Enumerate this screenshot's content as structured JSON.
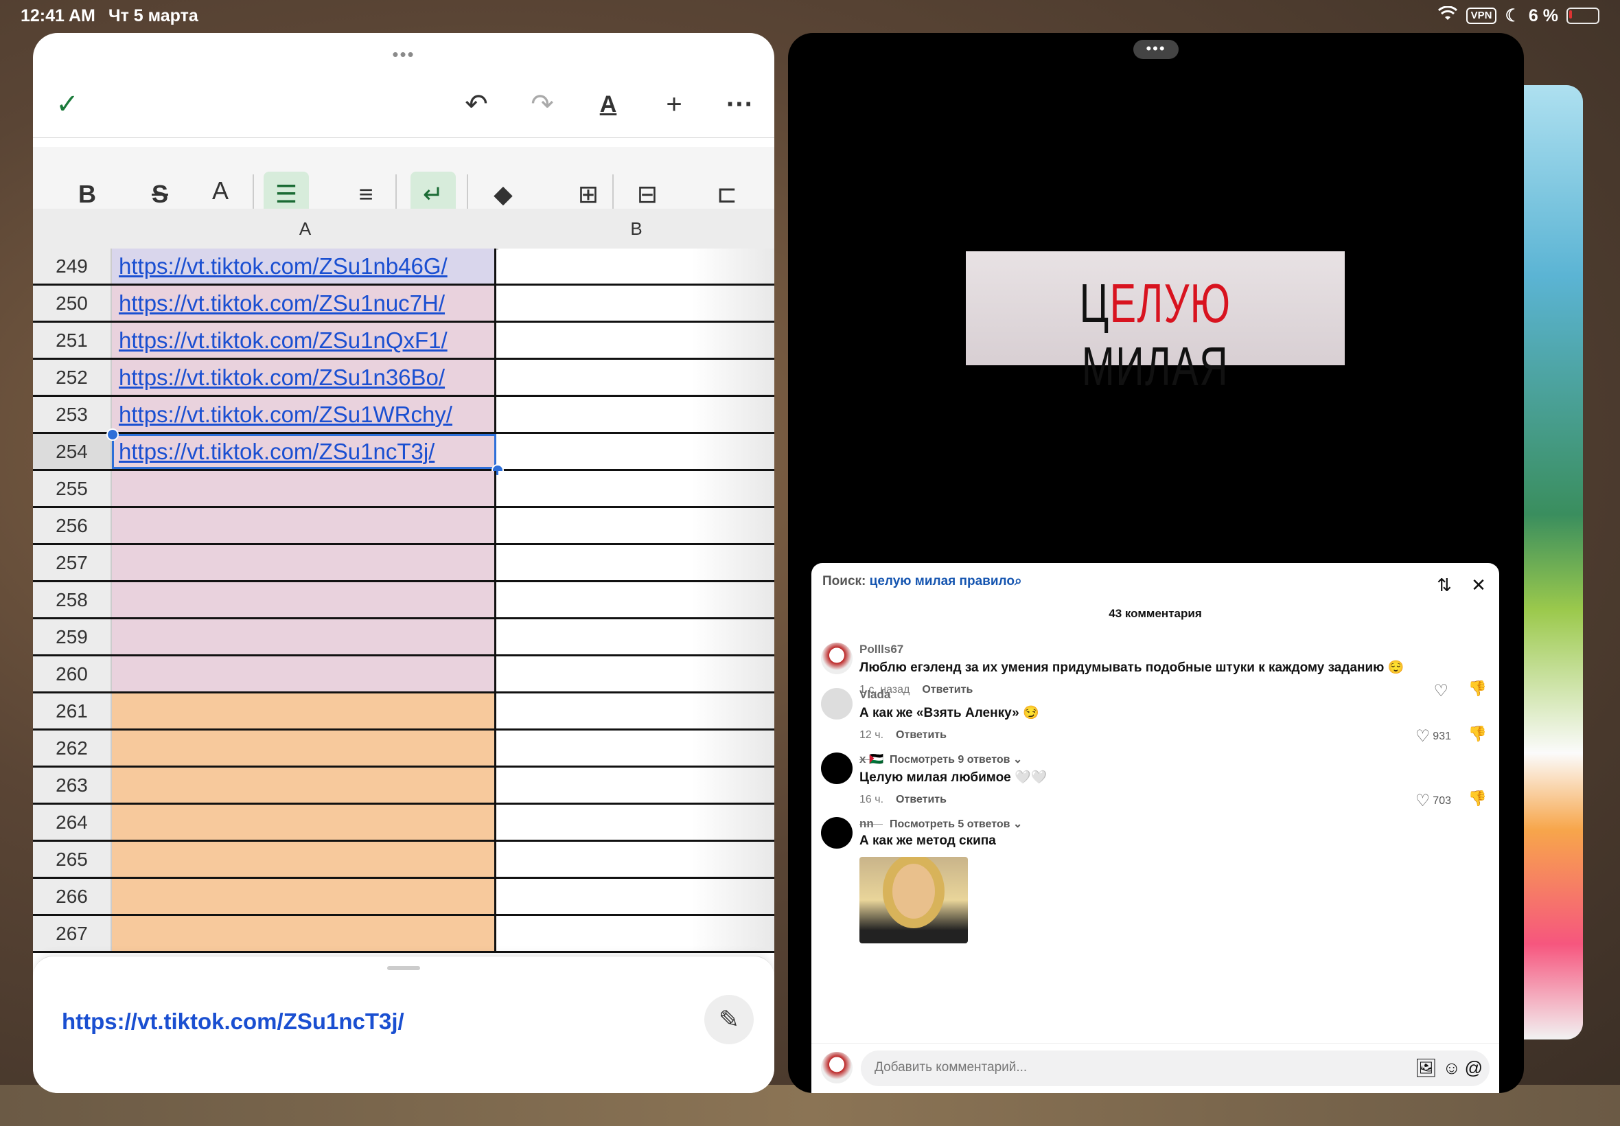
{
  "status": {
    "time": "12:41 AM",
    "date": "Чт 5 марта",
    "vpn": "VPN",
    "battery": "6 %"
  },
  "sheet": {
    "toolbar": {
      "confirm_icon": "check-icon",
      "undo_icon": "undo-icon",
      "redo_icon": "redo-icon",
      "text_format_icon": "text-format-icon",
      "add_icon": "plus-icon",
      "more_icon": "more-icon"
    },
    "format_bar": {
      "bold": "B",
      "strike": "S",
      "text_color": "A"
    },
    "columns": [
      "A",
      "B"
    ],
    "rows": [
      {
        "n": "249",
        "a": "https://vt.tiktok.com/ZSu1nb46G/",
        "fill": "lav"
      },
      {
        "n": "250",
        "a": "https://vt.tiktok.com/ZSu1nuc7H/",
        "fill": "pink"
      },
      {
        "n": "251",
        "a": "https://vt.tiktok.com/ZSu1nQxF1/",
        "fill": "pink"
      },
      {
        "n": "252",
        "a": "https://vt.tiktok.com/ZSu1n36Bo/",
        "fill": "pink"
      },
      {
        "n": "253",
        "a": "https://vt.tiktok.com/ZSu1WRchy/",
        "fill": "pink"
      },
      {
        "n": "254",
        "a": "https://vt.tiktok.com/ZSu1ncT3j/",
        "fill": "pink"
      },
      {
        "n": "255",
        "a": "",
        "fill": "pink"
      },
      {
        "n": "256",
        "a": "",
        "fill": "pink"
      },
      {
        "n": "257",
        "a": "",
        "fill": "pink"
      },
      {
        "n": "258",
        "a": "",
        "fill": "pink"
      },
      {
        "n": "259",
        "a": "",
        "fill": "pink"
      },
      {
        "n": "260",
        "a": "",
        "fill": "pink"
      },
      {
        "n": "261",
        "a": "",
        "fill": "orange"
      },
      {
        "n": "262",
        "a": "",
        "fill": "orange"
      },
      {
        "n": "263",
        "a": "",
        "fill": "orange"
      },
      {
        "n": "264",
        "a": "",
        "fill": "orange"
      },
      {
        "n": "265",
        "a": "",
        "fill": "orange"
      },
      {
        "n": "266",
        "a": "",
        "fill": "orange"
      },
      {
        "n": "267",
        "a": "",
        "fill": "orange"
      }
    ],
    "selected_row": "254",
    "cell_editor_value": "https://vt.tiktok.com/ZSu1ncT3j/",
    "colors": {
      "pink": "#e9d2dd",
      "lav": "#d9d6ec",
      "orange": "#f7c99c",
      "selection": "#2e6fd8",
      "link": "#1a4fd1"
    }
  },
  "tiktok": {
    "video_caption_black1": "Ц",
    "video_caption_red1": "ЕЛУЮ",
    "video_caption_black2": "МИЛАЯ",
    "search_label": "Поиск:",
    "search_query": "целую милая правило",
    "comment_count": "43 комментария",
    "comments": [
      {
        "user": "Pollls67",
        "text": "Люблю егэленд за их умения придумывать подобные штуки к каждому заданию 😌",
        "time": "1 с. назад",
        "reply": "Ответить",
        "likes": ""
      },
      {
        "user": "Vlada",
        "text": "А как же «Взять Аленку» 😏",
        "time": "12 ч.",
        "reply": "Ответить",
        "likes": "931",
        "replies": "Посмотреть 9 ответов ⌄"
      },
      {
        "user": "x 🇵🇸",
        "text": "Целую милая любимое 🤍🤍",
        "time": "16 ч.",
        "reply": "Ответить",
        "likes": "703",
        "replies": "Посмотреть 5 ответов ⌄"
      },
      {
        "user": "nn",
        "text": "А как же метод скипа"
      }
    ],
    "input_placeholder": "Добавить комментарий..."
  }
}
